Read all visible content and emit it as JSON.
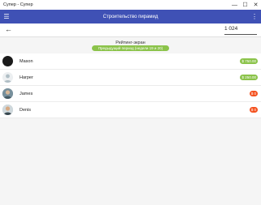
{
  "window": {
    "title": "Супер - Супер",
    "minimize_glyph": "—",
    "maximize_glyph": "☐",
    "close_glyph": "✕"
  },
  "appbar": {
    "title": "Строительство пирамид",
    "menu_icon": "☰",
    "more_icon": "⋮"
  },
  "toolbar": {
    "back_icon": "←",
    "value": "1 024"
  },
  "leaderboard": {
    "heading": "Рейтинг-экран",
    "period_label": "Предыдущий период (недели 19 и 20)",
    "accent_green": "#8bc34a",
    "accent_red": "#f4511e",
    "rows": [
      {
        "name": "Mason",
        "amount": "$ 750.00",
        "status": "positive",
        "avatar": "dark-circle-avatar"
      },
      {
        "name": "Harper",
        "amount": "$ 250.00",
        "status": "positive",
        "avatar": "default-person-avatar"
      },
      {
        "name": "James",
        "amount": "$ 0",
        "status": "negative",
        "avatar": "photo-avatar"
      },
      {
        "name": "Denis",
        "amount": "$ 0",
        "status": "negative",
        "avatar": "photo-avatar"
      }
    ]
  }
}
